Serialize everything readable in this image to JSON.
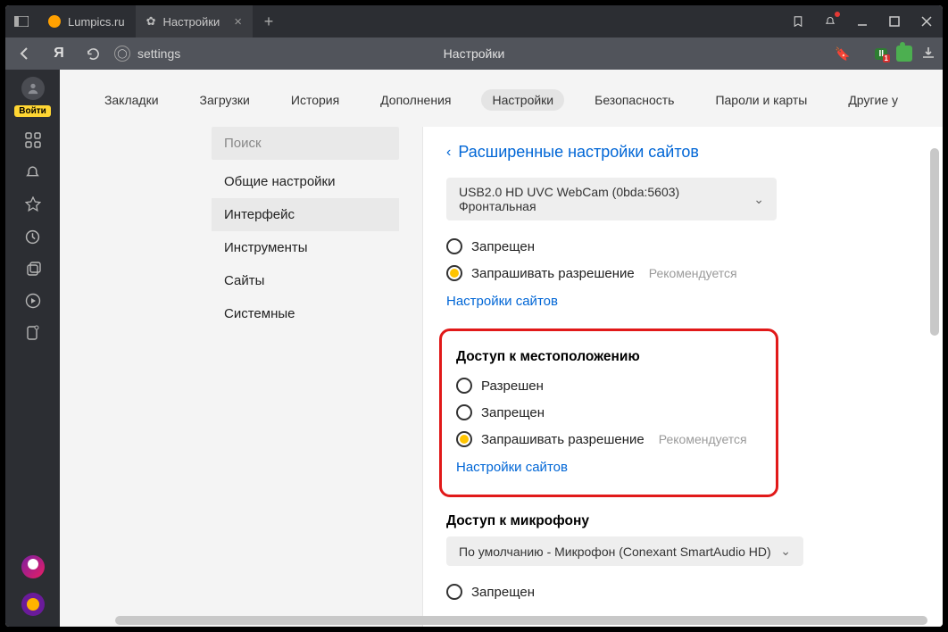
{
  "tabs": [
    {
      "label": "Lumpics.ru"
    },
    {
      "label": "Настройки"
    }
  ],
  "addrbar": {
    "url_text": "settings",
    "page_title": "Настройки",
    "ext_count": "1"
  },
  "leftbar": {
    "login_label": "Войти"
  },
  "nav": {
    "items": [
      "Закладки",
      "Загрузки",
      "История",
      "Дополнения",
      "Настройки",
      "Безопасность",
      "Пароли и карты",
      "Другие у"
    ],
    "active": 4
  },
  "sidebar": {
    "search_placeholder": "Поиск",
    "items": [
      "Общие настройки",
      "Интерфейс",
      "Инструменты",
      "Сайты",
      "Системные"
    ],
    "selected": 1
  },
  "panel": {
    "breadcrumb": "Расширенные настройки сайтов",
    "camera_select": "USB2.0 HD UVC WebCam (0bda:5603) Фронтальная",
    "blocked_label": "Запрещен",
    "ask_label": "Запрашивать разрешение",
    "recommended": "Рекомендуется",
    "site_settings_link": "Настройки сайтов",
    "location": {
      "title": "Доступ к местоположению",
      "allowed": "Разрешен",
      "blocked": "Запрещен",
      "ask": "Запрашивать разрешение"
    },
    "mic": {
      "title": "Доступ к микрофону",
      "select": "По умолчанию - Микрофон (Conexant SmartAudio HD)",
      "blocked": "Запрещен"
    }
  }
}
